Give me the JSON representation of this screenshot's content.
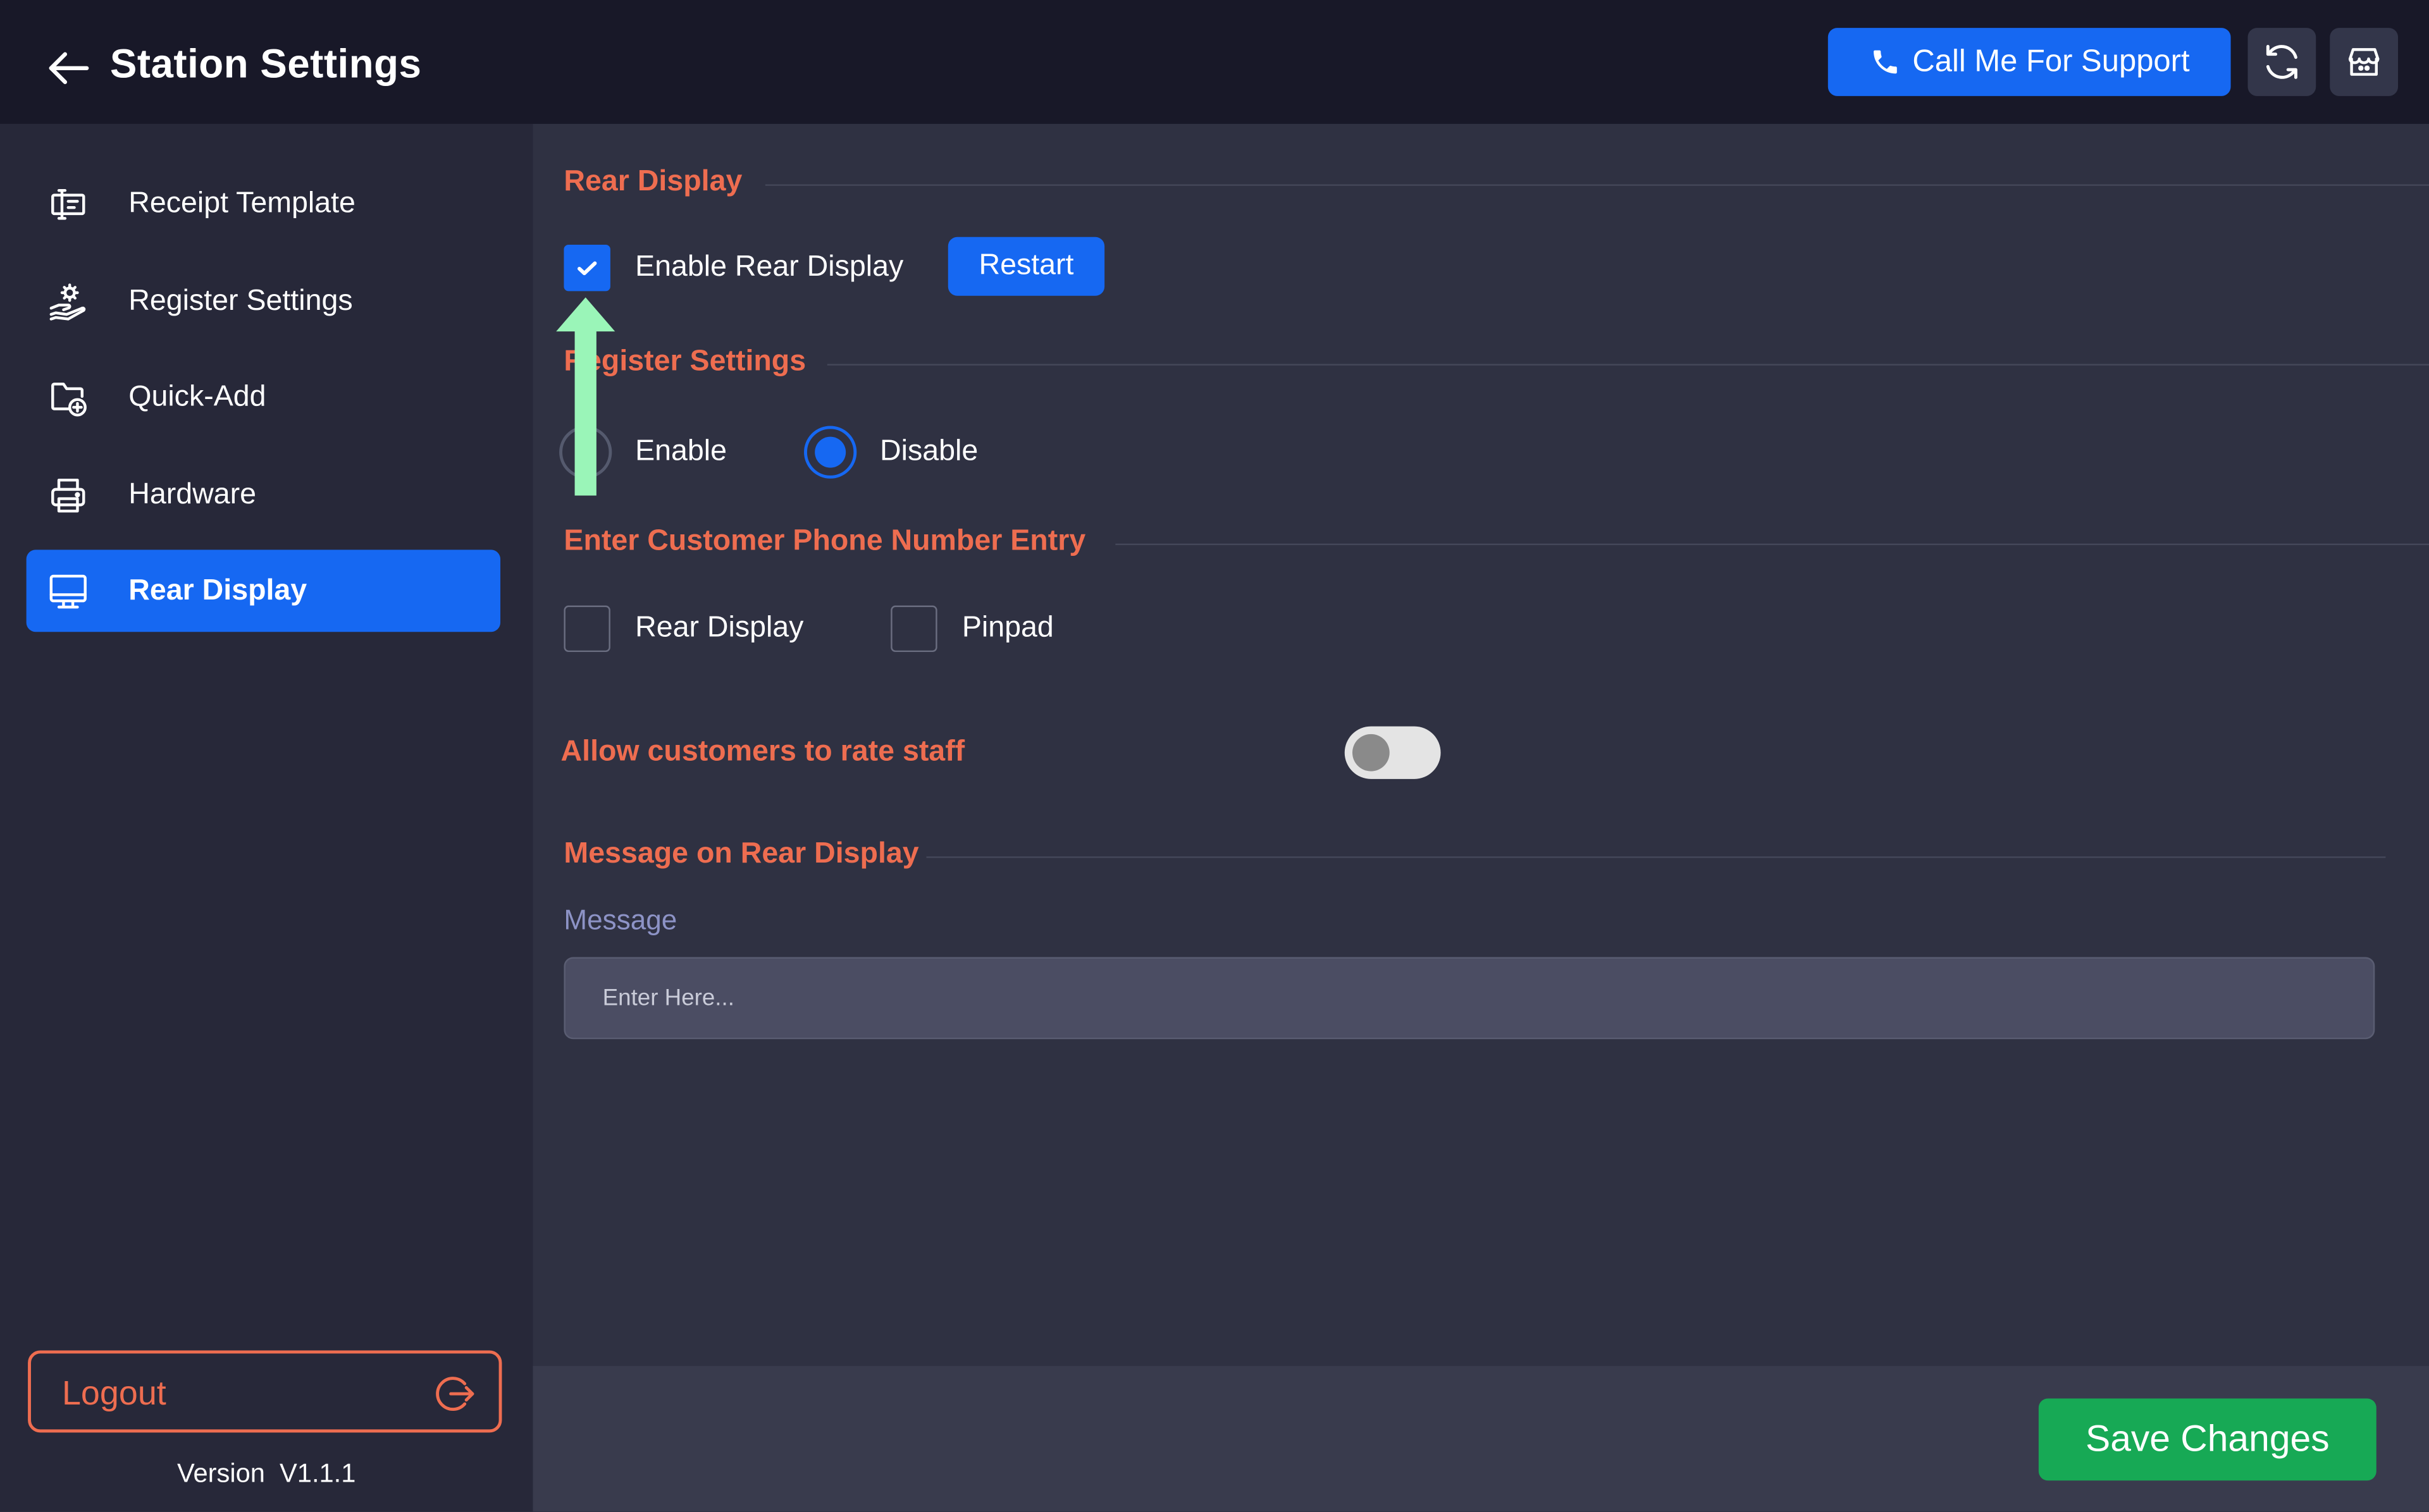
{
  "header": {
    "title": "Station Settings",
    "support_label": "Call Me For Support"
  },
  "sidebar": {
    "items": [
      {
        "label": "Receipt Template",
        "icon": "receipt-icon"
      },
      {
        "label": "Register Settings",
        "icon": "register-hand-icon"
      },
      {
        "label": "Quick-Add",
        "icon": "folder-add-icon"
      },
      {
        "label": "Hardware",
        "icon": "printer-icon"
      },
      {
        "label": "Rear Display",
        "icon": "monitor-icon",
        "active": true
      }
    ],
    "logout_label": "Logout",
    "version": "Version  V1.1.1"
  },
  "main": {
    "rear_display": {
      "title": "Rear Display",
      "enable_label": "Enable Rear Display",
      "enabled": true,
      "restart_label": "Restart"
    },
    "register_settings": {
      "title": "Register Settings",
      "enable_label": "Enable",
      "disable_label": "Disable",
      "selected": "Disable"
    },
    "phone_entry": {
      "title": "Enter Customer Phone Number Entry",
      "options": [
        {
          "label": "Rear Display",
          "checked": false
        },
        {
          "label": "Pinpad",
          "checked": false
        }
      ]
    },
    "rate_staff": {
      "label": "Allow customers to rate staff",
      "enabled": false
    },
    "message": {
      "title": "Message on Rear Display",
      "field_label": "Message",
      "value": "",
      "placeholder": "Enter Here..."
    }
  },
  "footer": {
    "save_label": "Save Changes"
  },
  "colors": {
    "accent": "#1668f2",
    "section_title": "#ee6d50",
    "save": "#17a955",
    "annotation_arrow": "#9af5b8"
  }
}
